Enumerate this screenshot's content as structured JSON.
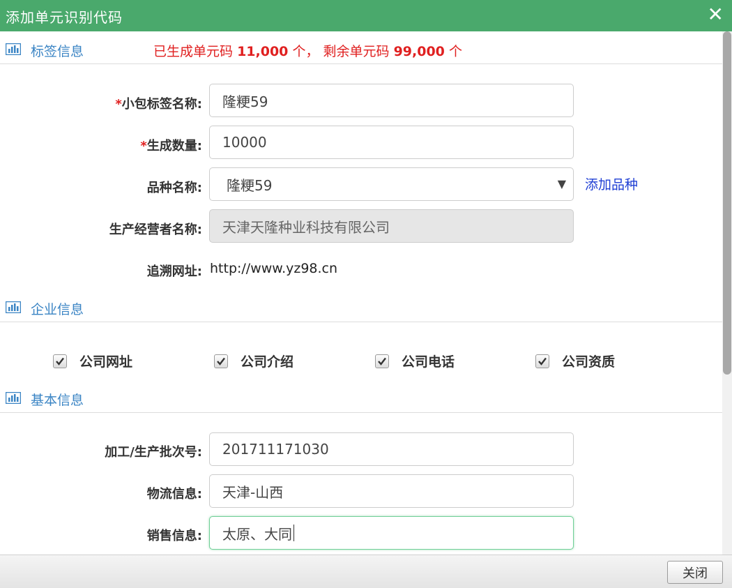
{
  "dialog": {
    "title": "添加单元识别代码",
    "close_glyph": "✕",
    "accent_color": "#4aa96c"
  },
  "summary": {
    "prefix": "已生成单元码",
    "generated": "11,000",
    "unit1": "个，",
    "remaining_label": "剩余单元码",
    "remaining": "99,000",
    "unit2": "个"
  },
  "sections": {
    "label_info": "标签信息",
    "company_info": "企业信息",
    "basic_info": "基本信息",
    "icon": "bar-chart-icon"
  },
  "form": {
    "required_mark": "*",
    "package_name_label": "小包标签名称:",
    "package_name_value": "隆粳59",
    "quantity_label": "生成数量:",
    "quantity_value": "10000",
    "variety_label": "品种名称:",
    "variety_value": "隆粳59",
    "add_variety_link": "添加品种",
    "producer_label": "生产经营者名称:",
    "producer_value": "天津天隆种业科技有限公司",
    "trace_url_label": "追溯网址:",
    "trace_url_value": "http://www.yz98.cn",
    "batch_label": "加工/生产批次号:",
    "batch_value": "201711171030",
    "logistics_label": "物流信息:",
    "logistics_value": "天津-山西",
    "sales_label": "销售信息:",
    "sales_value": "太原、大同"
  },
  "company_checks": [
    {
      "label": "公司网址",
      "checked": true
    },
    {
      "label": "公司介绍",
      "checked": true
    },
    {
      "label": "公司电话",
      "checked": true
    },
    {
      "label": "公司资质",
      "checked": true
    }
  ],
  "footer": {
    "close_button": "关闭"
  }
}
